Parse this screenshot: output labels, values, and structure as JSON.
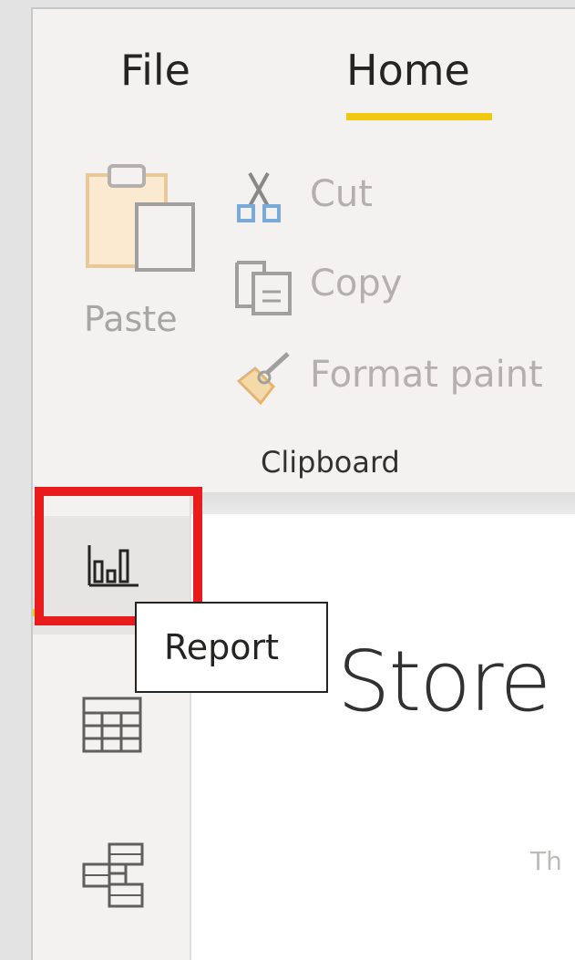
{
  "ribbon": {
    "tabs": [
      {
        "label": "File",
        "active": false
      },
      {
        "label": "Home",
        "active": true
      }
    ],
    "accent_color": "#f2c811",
    "clipboard": {
      "group_label": "Clipboard",
      "paste": {
        "label": "Paste",
        "icon": "paste-icon",
        "enabled": false
      },
      "cut": {
        "label": "Cut",
        "icon": "scissors-icon",
        "enabled": false
      },
      "copy": {
        "label": "Copy",
        "icon": "copy-icon",
        "enabled": false
      },
      "format_painter": {
        "label": "Format paint",
        "icon": "paintbrush-icon",
        "enabled": false
      }
    }
  },
  "left_nav": {
    "items": [
      {
        "name": "report",
        "icon": "bar-chart-icon",
        "active": true
      },
      {
        "name": "data",
        "icon": "table-grid-icon",
        "active": false
      },
      {
        "name": "model",
        "icon": "model-relationships-icon",
        "active": false
      }
    ]
  },
  "tooltip": {
    "text": "Report"
  },
  "highlight_color": "#e81c1c",
  "canvas": {
    "title": "Store",
    "subtitle": "Th"
  }
}
